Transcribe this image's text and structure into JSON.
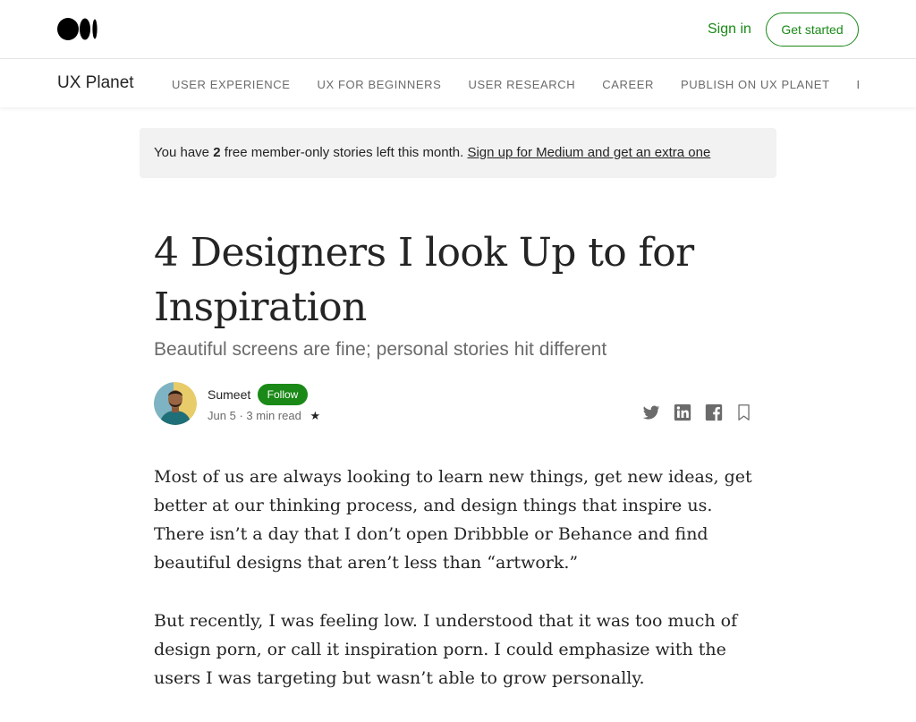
{
  "header": {
    "logo_icon": "medium-logo-icon",
    "signin_label": "Sign in",
    "get_started_label": "Get started",
    "accent_color": "#1a8917"
  },
  "publication": {
    "name": "UX Planet",
    "nav": [
      "USER EXPERIENCE",
      "UX FOR BEGINNERS",
      "USER RESEARCH",
      "CAREER",
      "PUBLISH ON UX PLANET",
      "ES"
    ]
  },
  "banner": {
    "prefix": "You have ",
    "count": "2",
    "suffix": " free member-only stories left this month. ",
    "link": "Sign up for Medium and get an extra one"
  },
  "article": {
    "title": "4 Designers I look Up to for Inspiration",
    "subtitle": "Beautiful screens are fine; personal stories hit different",
    "author": "Sumeet",
    "follow_label": "Follow",
    "date": "Jun 5",
    "separator": "·",
    "read_time": "3 min read",
    "member_icon": "star-icon",
    "share_icons": [
      "twitter-icon",
      "linkedin-icon",
      "facebook-icon",
      "bookmark-icon"
    ],
    "paragraphs": [
      "Most of us are always looking to learn new things, get new ideas, get better at our thinking process, and design things that inspire us. There isn’t a day that I don’t open Dribbble or Behance and find beautiful designs that aren’t less than “artwork.”",
      "But recently, I was feeling low. I understood that it was too much of design porn, or call it inspiration porn. I could emphasize with the users I was targeting but wasn’t able to grow personally."
    ]
  }
}
